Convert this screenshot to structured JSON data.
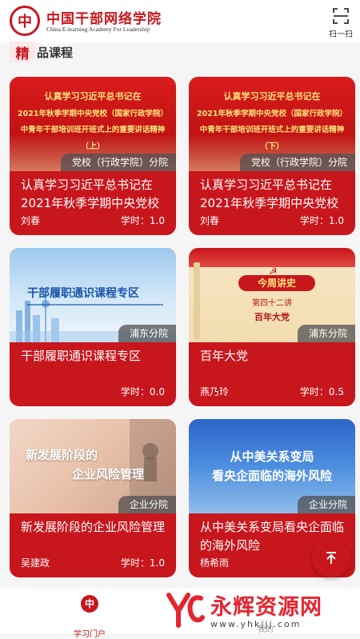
{
  "header": {
    "brand_mark": "中",
    "brand_cn": "中国干部网络学院",
    "brand_en": "China E-learning Academy For Leadership",
    "scan_label": "扫一扫"
  },
  "section": {
    "badge": "精",
    "title": "品课程"
  },
  "courses": [
    {
      "thumb_lines": [
        "认真学习习近平总书记在",
        "2021年秋季学期中央党校（国家行政学院）",
        "中青年干部培训班开班式上的重要讲话精神",
        "（上）"
      ],
      "tag": "党校（行政学院）分院",
      "title": "认真学习习近平总书记在2021年秋季学期中央党校",
      "author": "刘春",
      "hours": "学时：1.0"
    },
    {
      "thumb_lines": [
        "认真学习习近平总书记在",
        "2021年秋季学期中央党校（国家行政学院）",
        "中青年干部培训班开班式上的重要讲话精神",
        "（下）"
      ],
      "tag": "党校（行政学院）分院",
      "title": "认真学习习近平总书记在2021年秋季学期中央党校",
      "author": "刘春",
      "hours": "学时：1.0"
    },
    {
      "thumb_lines": [
        "干部履职通识课程专区"
      ],
      "tag": "浦东分院",
      "title": "干部履职通识课程专区",
      "author": "",
      "hours": "学时：0.0"
    },
    {
      "thumb_lines": [
        "今周讲史",
        "第四十二讲",
        "百年大党"
      ],
      "tag": "浦东分院",
      "title": "百年大党",
      "author": "燕乃玲",
      "hours": "学时：0.5"
    },
    {
      "thumb_lines": [
        "新发展阶段的",
        "企业风险管理"
      ],
      "tag": "企业分院",
      "title": "新发展阶段的企业风险管理",
      "author": "吴建政",
      "hours": "学时：1.0"
    },
    {
      "thumb_lines": [
        "从中美关系变局",
        "看央企面临的海外风险"
      ],
      "tag": "企业分院",
      "title": "从中美关系变局看央企面临的海外风险",
      "author": "杨希雨",
      "hours": "学时"
    }
  ],
  "tabbar": {
    "home_label": "学习门户",
    "home_mark": "中",
    "mine_label": "我的"
  },
  "watermark": {
    "cn": "永辉资源网",
    "url": "www.yhkjjj.com"
  },
  "colors": {
    "brand_red": "#c8161d",
    "watermark_red": "#e4252f"
  }
}
